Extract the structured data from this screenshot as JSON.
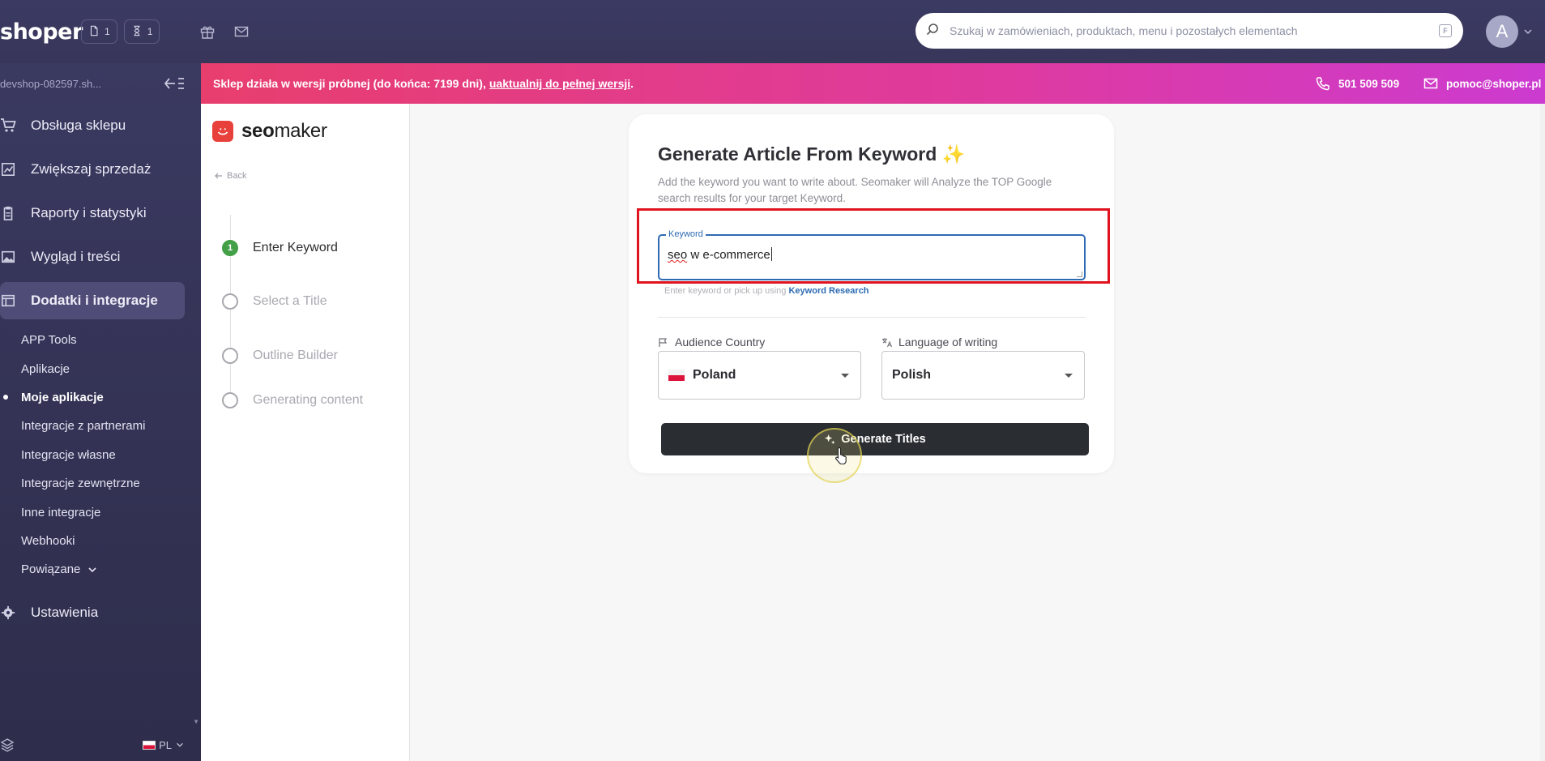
{
  "topbar": {
    "logo": "shoper",
    "orders_count": "1",
    "pending_count": "1",
    "search_placeholder": "Szukaj w zamówieniach, produktach, menu i pozostałych elementach",
    "search_shortcut": "F",
    "avatar_letter": "A"
  },
  "sidebar": {
    "shop_name": "devshop-082597.sh...",
    "items": [
      {
        "label": "Obsługa sklepu",
        "icon": "cart-icon"
      },
      {
        "label": "Zwiększaj sprzedaż",
        "icon": "chart-icon"
      },
      {
        "label": "Raporty i statystyki",
        "icon": "clipboard-icon"
      },
      {
        "label": "Wygląd i treści",
        "icon": "image-icon"
      },
      {
        "label": "Dodatki i integracje",
        "icon": "window-icon"
      }
    ],
    "sub_items": [
      "APP Tools",
      "Aplikacje",
      "Moje aplikacje",
      "Integracje z partnerami",
      "Integracje własne",
      "Integracje zewnętrzne",
      "Inne integracje",
      "Webhooki",
      "Powiązane"
    ],
    "settings_label": "Ustawienia",
    "language": "PL"
  },
  "banner": {
    "text": "Sklep działa w wersji próbnej (do końca: 7199 dni),",
    "link": "uaktualnij do pełnej wersji",
    "link_suffix": ".",
    "phone": "501 509 509",
    "email": "pomoc@shoper.pl"
  },
  "app": {
    "brand_bold": "seo",
    "brand_rest": "maker",
    "back_label": "Back",
    "steps": [
      {
        "num": "1",
        "label": "Enter Keyword",
        "active": true
      },
      {
        "num": "",
        "label": "Select a Title",
        "active": false
      },
      {
        "num": "",
        "label": "Outline Builder",
        "active": false
      },
      {
        "num": "",
        "label": "Generating content",
        "active": false
      }
    ],
    "card": {
      "title": "Generate Article From Keyword",
      "title_emoji": "✨",
      "description": "Add the keyword you want to write about. Seomaker will Analyze the TOP Google search results for your target Keyword.",
      "keyword_label": "Keyword",
      "keyword_value_word": "seo",
      "keyword_value_rest": " w e-commerce",
      "helper_text": "Enter keyword or pick up using",
      "helper_link": "Keyword Research",
      "country_label": "Audience Country",
      "country_value": "Poland",
      "language_label": "Language of writing",
      "language_value": "Polish",
      "button_label": "Generate Titles"
    }
  }
}
